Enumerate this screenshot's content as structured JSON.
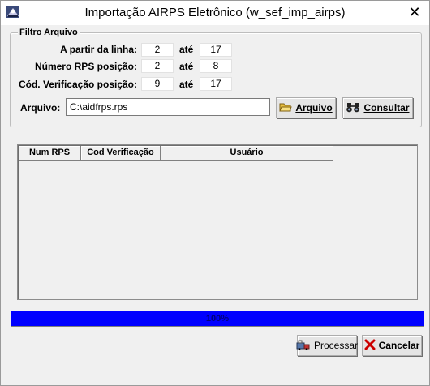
{
  "window": {
    "title": "Importação AIRPS Eletrônico (w_sef_imp_airps)",
    "close_glyph": "✕"
  },
  "filtro": {
    "group_label": "Filtro Arquivo",
    "rows": [
      {
        "label": "A partir da linha:",
        "from": "2",
        "to_label": "até",
        "to": "17"
      },
      {
        "label": "Número RPS posição:",
        "from": "2",
        "to_label": "até",
        "to": "8"
      },
      {
        "label": "Cód. Verificação posição:",
        "from": "9",
        "to_label": "até",
        "to": "17"
      }
    ],
    "arquivo_label": "Arquivo:",
    "arquivo_value": "C:\\aidfrps.rps",
    "arquivo_button": "Arquivo",
    "consultar_button": "Consultar"
  },
  "grid": {
    "columns": [
      "Num RPS",
      "Cod Verificação",
      "Usuário"
    ]
  },
  "progress": {
    "value": 100,
    "text": "100%"
  },
  "footer": {
    "processar_button": "Processar",
    "cancelar_button": "Cancelar"
  },
  "colors": {
    "progress_fill": "#0000ff",
    "cancel_x": "#cc0000"
  }
}
